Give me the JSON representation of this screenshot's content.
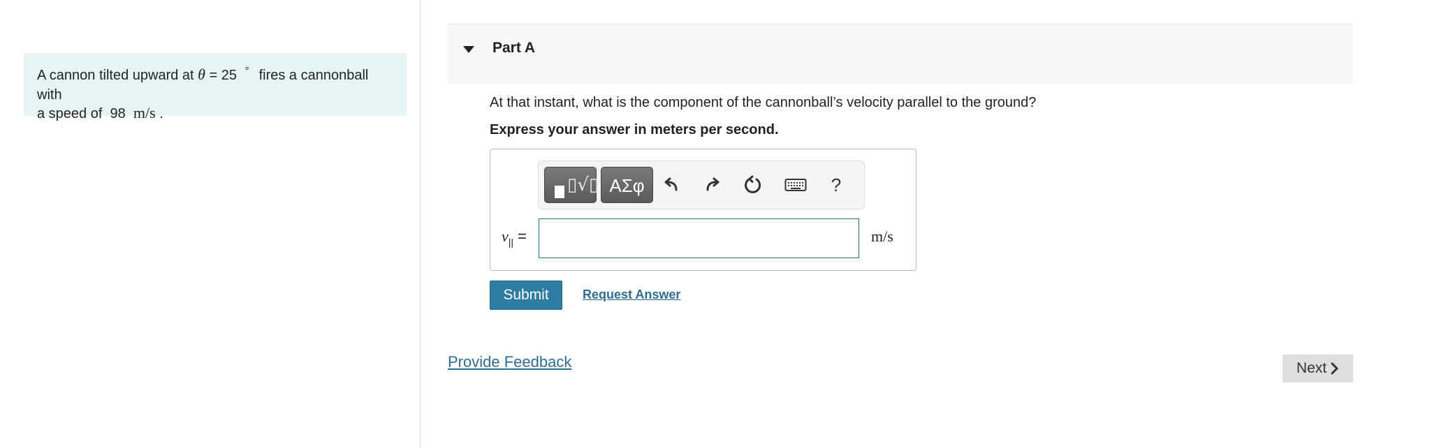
{
  "problem": {
    "text_before": "A cannon tilted upward at",
    "theta_symbol": "θ",
    "equals": " = 25",
    "degree": "°",
    "text_after": "fires a cannonball with",
    "speed_prefix": "a speed of",
    "speed_value": "98",
    "speed_unit": "m/s",
    "period": "."
  },
  "part": {
    "title": "Part A",
    "question": "At that instant, what is the component of the cannonball’s velocity parallel to the ground?",
    "instruction": "Express your answer in meters per second."
  },
  "toolbar": {
    "templates_icon": "templates-icon",
    "symbols_label": "ΑΣφ",
    "undo_icon": "undo-icon",
    "redo_icon": "redo-icon",
    "reset_icon": "reset-icon",
    "keyboard_icon": "keyboard-icon",
    "help_label": "?"
  },
  "answer": {
    "variable": "v",
    "subscript": "||",
    "equals": "=",
    "value": "",
    "unit": "m/s"
  },
  "actions": {
    "submit_label": "Submit",
    "request_answer_label": "Request Answer",
    "provide_feedback_label": "Provide Feedback",
    "next_label": "Next"
  },
  "colors": {
    "problem_bg": "#e6f4f6",
    "submit_bg": "#2e7ca1",
    "link": "#2d6f93",
    "next_bg": "#dedede"
  }
}
